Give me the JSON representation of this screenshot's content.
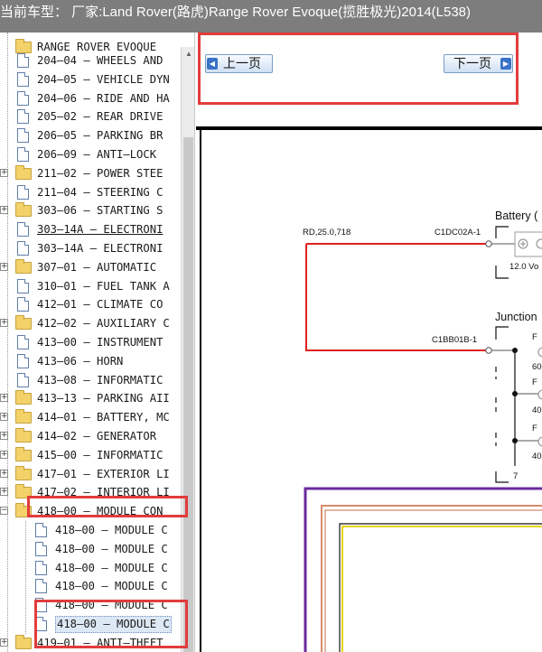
{
  "title_bar": {
    "text": "当前车型： 厂家:Land Rover(路虎)Range Rover Evoque(揽胜极光)2014(L538)"
  },
  "tree": {
    "top_partial": "RANGE ROVER EVOQUE",
    "items": [
      {
        "label": "204—04 — WHEELS AND",
        "type": "doc"
      },
      {
        "label": "204—05 — VEHICLE DYN",
        "type": "doc"
      },
      {
        "label": "204—06 — RIDE AND HA",
        "type": "doc"
      },
      {
        "label": "205—02 — REAR DRIVE",
        "type": "doc"
      },
      {
        "label": "206—05 — PARKING BR",
        "type": "doc"
      },
      {
        "label": "206—09 — ANTI—LOCK",
        "type": "doc"
      },
      {
        "label": "211—02 — POWER STEE",
        "type": "folder"
      },
      {
        "label": "211—04 — STEERING C",
        "type": "doc"
      },
      {
        "label": "303—06 — STARTING S",
        "type": "folder"
      },
      {
        "label": "303—14A — ELECTRONI",
        "type": "doc",
        "link": true
      },
      {
        "label": "303—14A — ELECTRONI",
        "type": "doc"
      },
      {
        "label": "307—01 — AUTOMATIC",
        "type": "folder"
      },
      {
        "label": "310—01 — FUEL TANK A",
        "type": "doc"
      },
      {
        "label": "412—01 — CLIMATE CO",
        "type": "doc"
      },
      {
        "label": "412—02 — AUXILIARY C",
        "type": "folder"
      },
      {
        "label": "413—00 — INSTRUMENT",
        "type": "doc"
      },
      {
        "label": "413—06 — HORN",
        "type": "doc"
      },
      {
        "label": "413—08 — INFORMATIC",
        "type": "doc"
      },
      {
        "label": "413—13 — PARKING AII",
        "type": "folder"
      },
      {
        "label": "414—01 — BATTERY, MC",
        "type": "folder"
      },
      {
        "label": "414—02 — GENERATOR",
        "type": "folder"
      },
      {
        "label": "415—00 — INFORMATIC",
        "type": "folder"
      },
      {
        "label": "417—01 — EXTERIOR LI",
        "type": "folder"
      },
      {
        "label": "417—02 — INTERIOR LI",
        "type": "folder"
      },
      {
        "label": "418—00 — MODULE CON",
        "type": "folder",
        "expanded": true
      },
      {
        "label": "418—00 — MODULE C",
        "type": "doc",
        "sub": true
      },
      {
        "label": "418—00 — MODULE C",
        "type": "doc",
        "sub": true
      },
      {
        "label": "418—00 — MODULE C",
        "type": "doc",
        "sub": true
      },
      {
        "label": "418—00 — MODULE C",
        "type": "doc",
        "sub": true
      },
      {
        "label": "418—00 — MODULE C",
        "type": "doc",
        "sub": true
      },
      {
        "label": "418—00 — MODULE C",
        "type": "doc",
        "sub": true,
        "selected": true
      },
      {
        "label": "419—01 — ANTI—THEFT",
        "type": "folder"
      }
    ]
  },
  "nav": {
    "prev_label": "上一页",
    "next_label": "下一页"
  },
  "diagram": {
    "wire_label": "RD,25.0,718",
    "connector_1": "C1DC02A-1",
    "connector_2": "C1BB01B-1",
    "battery_label": "Battery (",
    "battery_spec": "12.0 Vo",
    "junction_label": "Junction",
    "fuse_prefix": "F",
    "fuse_values": [
      "60",
      "40",
      "40"
    ]
  },
  "colors": {
    "wire": "#e02020",
    "highlight": "#e23c3c",
    "frame_outer": "#6a2a9c",
    "frame_inner": "#d98a6a",
    "frame_innermost": "#e8d200"
  }
}
